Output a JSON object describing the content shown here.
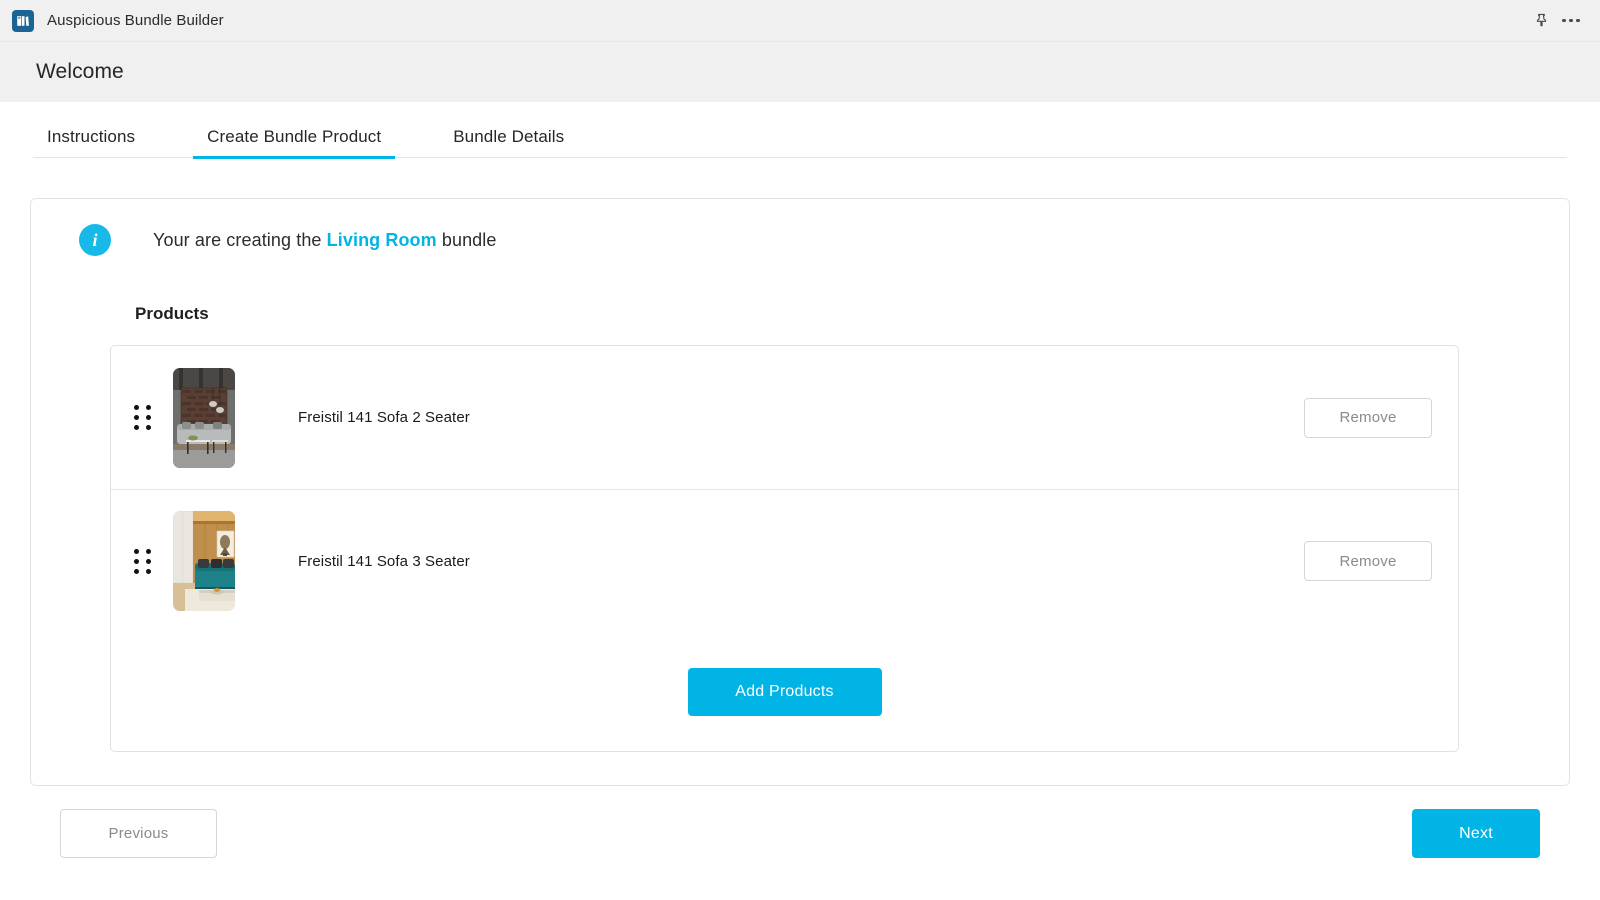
{
  "titlebar": {
    "app_name": "Auspicious Bundle Builder",
    "app_icon": "bundle-app-icon",
    "pin_icon": "pin-icon",
    "more_icon": "more-options-icon",
    "icon_bg": "#1a6496"
  },
  "header": {
    "title": "Welcome"
  },
  "tabs": {
    "items": [
      {
        "label": "Instructions",
        "active": false
      },
      {
        "label": "Create Bundle Product",
        "active": true
      },
      {
        "label": "Bundle Details",
        "active": false
      }
    ],
    "active_underline_color": "#00b4e6"
  },
  "banner": {
    "icon": "info-icon",
    "icon_color": "#16b9e8",
    "text_before": "Your are creating the ",
    "highlight": "Living Room",
    "highlight_color": "#00b4e6",
    "text_after": " bundle"
  },
  "products_section": {
    "heading": "Products",
    "rows": [
      {
        "drag_handle": "drag-handle-icon",
        "thumbnail": "living-room-grey-sofa-brick-wall",
        "name": "Freistil 141 Sofa 2 Seater",
        "remove_label": "Remove"
      },
      {
        "drag_handle": "drag-handle-icon",
        "thumbnail": "living-room-teal-sofa-wood-wall",
        "name": "Freistil 141 Sofa 3 Seater",
        "remove_label": "Remove"
      }
    ],
    "add_products_label": "Add Products",
    "add_products_color": "#00b4e6"
  },
  "footer": {
    "previous_label": "Previous",
    "next_label": "Next",
    "next_color": "#00b4e6"
  }
}
